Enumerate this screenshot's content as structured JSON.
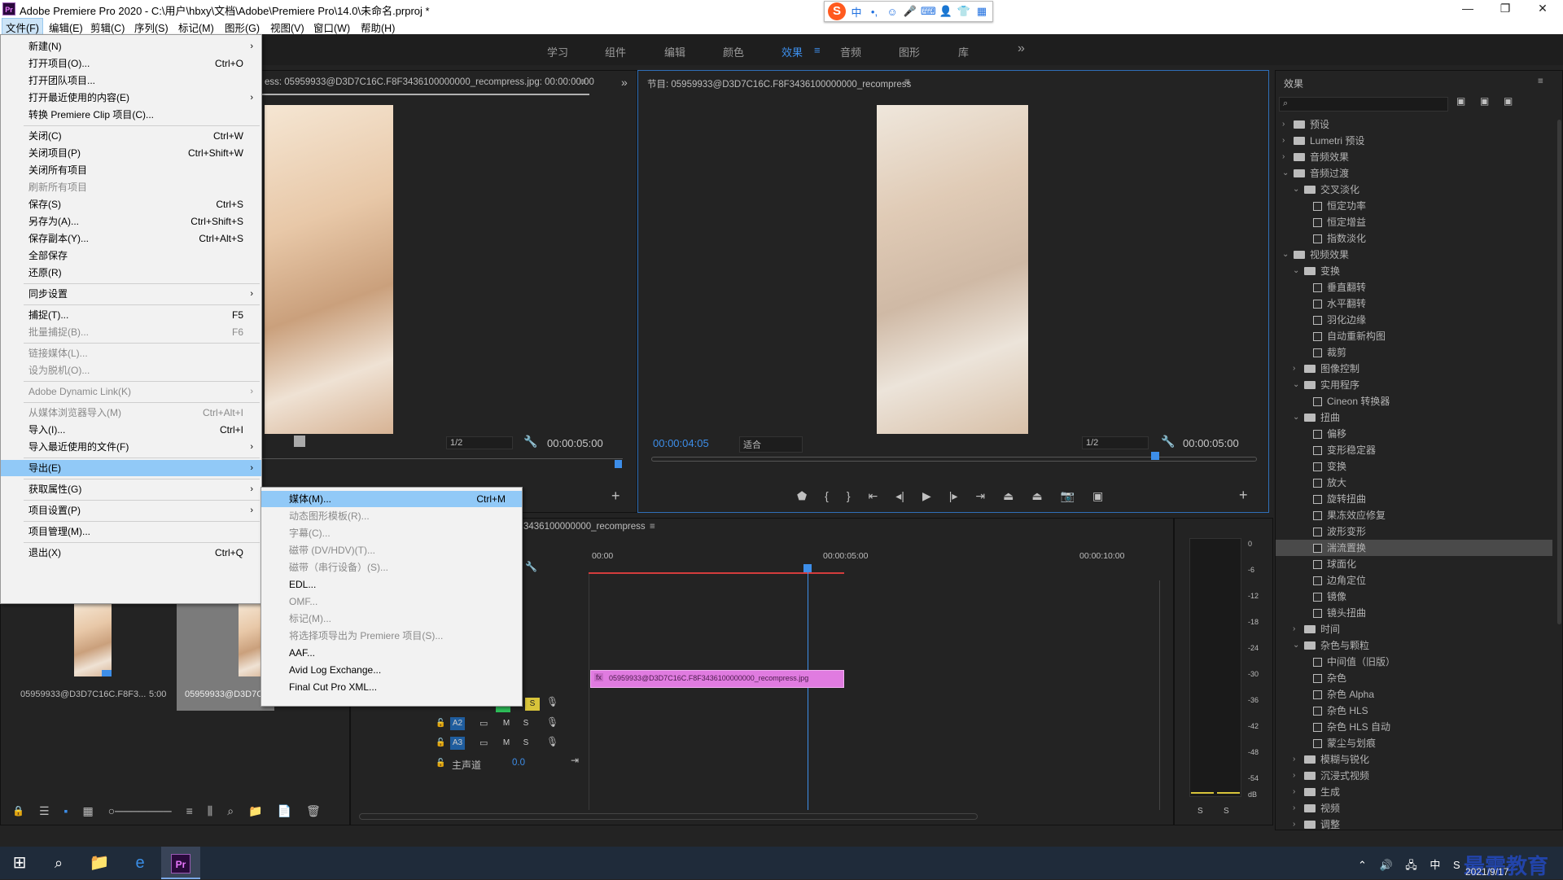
{
  "titlebar": {
    "app_logo": "Pr",
    "title": "Adobe Premiere Pro 2020 - C:\\用户\\hbxy\\文档\\Adobe\\Premiere Pro\\14.0\\未命名.prproj *",
    "minimize": "—",
    "maximize": "❐",
    "close": "✕"
  },
  "ime": {
    "logo": "S",
    "items": [
      "中",
      "•,",
      "☺",
      "🎤",
      "⌨",
      "👤",
      "👕",
      "▦"
    ]
  },
  "menubar": [
    "文件(F)",
    "编辑(E)",
    "剪辑(C)",
    "序列(S)",
    "标记(M)",
    "图形(G)",
    "视图(V)",
    "窗口(W)",
    "帮助(H)"
  ],
  "workspaces": {
    "tabs": [
      "学习",
      "组件",
      "编辑",
      "颜色",
      "效果",
      "音频",
      "图形",
      "库"
    ],
    "active": "效果",
    "more": "»"
  },
  "source_monitor": {
    "title": "ess: 05959933@D3D7C16C.F8F3436100000000_recompress.jpg: 00:00:00:00",
    "zoom": "1/2",
    "duration": "00:00:05:00"
  },
  "program_monitor": {
    "title": "节目: 05959933@D3D7C16C.F8F3436100000000_recompress",
    "current_time": "00:00:04:05",
    "fit": "适合",
    "zoom": "1/2",
    "duration": "00:00:05:00"
  },
  "timeline": {
    "title": "3436100000000_recompress",
    "ruler": [
      "00:00",
      "00:00:05:00",
      "00:00:10:00"
    ],
    "clip_label": "05959933@D3D7C16C.F8F3436100000000_recompress.jpg",
    "clip_fx": "fx",
    "tracks": [
      {
        "name": "A2",
        "m": "M",
        "s": "S"
      },
      {
        "name": "A3",
        "m": "M",
        "s": "S"
      }
    ],
    "v_s": "S",
    "master_label": "主声道",
    "master_value": "0.0"
  },
  "project": {
    "items": [
      {
        "name": "05959933@D3D7C16C.F8F3...",
        "duration": "5:00"
      },
      {
        "name": "05959933@D3D7C",
        "duration": ""
      }
    ]
  },
  "meter": {
    "scale": [
      "0",
      "-6",
      "-12",
      "-18",
      "-24",
      "-30",
      "-36",
      "-42",
      "-48",
      "-54",
      "dB"
    ],
    "s1": "S",
    "s2": "S"
  },
  "effects": {
    "title": "效果",
    "tree": [
      {
        "label": "预设",
        "level": 0,
        "type": "folder",
        "open": false
      },
      {
        "label": "Lumetri 预设",
        "level": 0,
        "type": "folder",
        "open": false
      },
      {
        "label": "音频效果",
        "level": 0,
        "type": "folder",
        "open": false
      },
      {
        "label": "音频过渡",
        "level": 0,
        "type": "folder",
        "open": true
      },
      {
        "label": "交叉淡化",
        "level": 1,
        "type": "folder",
        "open": true
      },
      {
        "label": "恒定功率",
        "level": 2,
        "type": "fx"
      },
      {
        "label": "恒定增益",
        "level": 2,
        "type": "fx"
      },
      {
        "label": "指数淡化",
        "level": 2,
        "type": "fx"
      },
      {
        "label": "视频效果",
        "level": 0,
        "type": "folder",
        "open": true
      },
      {
        "label": "变换",
        "level": 1,
        "type": "folder",
        "open": true
      },
      {
        "label": "垂直翻转",
        "level": 2,
        "type": "fx"
      },
      {
        "label": "水平翻转",
        "level": 2,
        "type": "fx"
      },
      {
        "label": "羽化边缘",
        "level": 2,
        "type": "fx"
      },
      {
        "label": "自动重新构图",
        "level": 2,
        "type": "fx"
      },
      {
        "label": "裁剪",
        "level": 2,
        "type": "fx"
      },
      {
        "label": "图像控制",
        "level": 1,
        "type": "folder",
        "open": false
      },
      {
        "label": "实用程序",
        "level": 1,
        "type": "folder",
        "open": true
      },
      {
        "label": "Cineon 转换器",
        "level": 2,
        "type": "fx"
      },
      {
        "label": "扭曲",
        "level": 1,
        "type": "folder",
        "open": true
      },
      {
        "label": "偏移",
        "level": 2,
        "type": "fx"
      },
      {
        "label": "变形稳定器",
        "level": 2,
        "type": "fx"
      },
      {
        "label": "变换",
        "level": 2,
        "type": "fx"
      },
      {
        "label": "放大",
        "level": 2,
        "type": "fx"
      },
      {
        "label": "旋转扭曲",
        "level": 2,
        "type": "fx"
      },
      {
        "label": "果冻效应修复",
        "level": 2,
        "type": "fx"
      },
      {
        "label": "波形变形",
        "level": 2,
        "type": "fx"
      },
      {
        "label": "湍流置换",
        "level": 2,
        "type": "fx",
        "selected": true
      },
      {
        "label": "球面化",
        "level": 2,
        "type": "fx"
      },
      {
        "label": "边角定位",
        "level": 2,
        "type": "fx"
      },
      {
        "label": "镜像",
        "level": 2,
        "type": "fx"
      },
      {
        "label": "镜头扭曲",
        "level": 2,
        "type": "fx"
      },
      {
        "label": "时间",
        "level": 1,
        "type": "folder",
        "open": false
      },
      {
        "label": "杂色与颗粒",
        "level": 1,
        "type": "folder",
        "open": true
      },
      {
        "label": "中间值（旧版）",
        "level": 2,
        "type": "fx"
      },
      {
        "label": "杂色",
        "level": 2,
        "type": "fx"
      },
      {
        "label": "杂色 Alpha",
        "level": 2,
        "type": "fx"
      },
      {
        "label": "杂色 HLS",
        "level": 2,
        "type": "fx"
      },
      {
        "label": "杂色 HLS 自动",
        "level": 2,
        "type": "fx"
      },
      {
        "label": "蒙尘与划痕",
        "level": 2,
        "type": "fx"
      },
      {
        "label": "模糊与锐化",
        "level": 1,
        "type": "folder",
        "open": false
      },
      {
        "label": "沉浸式视频",
        "level": 1,
        "type": "folder",
        "open": false
      },
      {
        "label": "生成",
        "level": 1,
        "type": "folder",
        "open": false
      },
      {
        "label": "视频",
        "level": 1,
        "type": "folder",
        "open": false
      },
      {
        "label": "调整",
        "level": 1,
        "type": "folder",
        "open": false
      }
    ]
  },
  "file_menu": {
    "items": [
      {
        "label": "新建(N)",
        "shortcut": "",
        "sub": true
      },
      {
        "label": "打开项目(O)...",
        "shortcut": "Ctrl+O"
      },
      {
        "label": "打开团队项目..."
      },
      {
        "label": "打开最近使用的内容(E)",
        "sub": true
      },
      {
        "label": "转换 Premiere Clip 项目(C)..."
      },
      {
        "sep": true
      },
      {
        "label": "关闭(C)",
        "shortcut": "Ctrl+W"
      },
      {
        "label": "关闭项目(P)",
        "shortcut": "Ctrl+Shift+W"
      },
      {
        "label": "关闭所有项目"
      },
      {
        "label": "刷新所有项目",
        "disabled": true
      },
      {
        "label": "保存(S)",
        "shortcut": "Ctrl+S"
      },
      {
        "label": "另存为(A)...",
        "shortcut": "Ctrl+Shift+S"
      },
      {
        "label": "保存副本(Y)...",
        "shortcut": "Ctrl+Alt+S"
      },
      {
        "label": "全部保存"
      },
      {
        "label": "还原(R)"
      },
      {
        "sep": true
      },
      {
        "label": "同步设置",
        "sub": true
      },
      {
        "sep": true
      },
      {
        "label": "捕捉(T)...",
        "shortcut": "F5"
      },
      {
        "label": "批量捕捉(B)...",
        "shortcut": "F6",
        "disabled": true
      },
      {
        "sep": true
      },
      {
        "label": "链接媒体(L)...",
        "disabled": true
      },
      {
        "label": "设为脱机(O)...",
        "disabled": true
      },
      {
        "sep": true
      },
      {
        "label": "Adobe Dynamic Link(K)",
        "sub": true,
        "disabled": true
      },
      {
        "sep": true
      },
      {
        "label": "从媒体浏览器导入(M)",
        "shortcut": "Ctrl+Alt+I",
        "disabled": true
      },
      {
        "label": "导入(I)...",
        "shortcut": "Ctrl+I"
      },
      {
        "label": "导入最近使用的文件(F)",
        "sub": true
      },
      {
        "sep": true
      },
      {
        "label": "导出(E)",
        "sub": true,
        "highlight": true
      },
      {
        "sep": true
      },
      {
        "label": "获取属性(G)",
        "sub": true
      },
      {
        "sep": true
      },
      {
        "label": "项目设置(P)",
        "sub": true
      },
      {
        "sep": true
      },
      {
        "label": "项目管理(M)..."
      },
      {
        "sep": true
      },
      {
        "label": "退出(X)",
        "shortcut": "Ctrl+Q"
      }
    ]
  },
  "export_menu": {
    "items": [
      {
        "label": "媒体(M)...",
        "shortcut": "Ctrl+M",
        "highlight": true
      },
      {
        "label": "动态图形模板(R)...",
        "disabled": true
      },
      {
        "label": "字幕(C)...",
        "disabled": true
      },
      {
        "label": "磁带 (DV/HDV)(T)...",
        "disabled": true
      },
      {
        "label": "磁带（串行设备）(S)...",
        "disabled": true
      },
      {
        "label": "EDL..."
      },
      {
        "label": "OMF...",
        "disabled": true
      },
      {
        "label": "标记(M)...",
        "disabled": true
      },
      {
        "label": "将选择项导出为 Premiere 项目(S)...",
        "disabled": true
      },
      {
        "label": "AAF..."
      },
      {
        "label": "Avid Log Exchange..."
      },
      {
        "label": "Final Cut Pro XML..."
      }
    ]
  },
  "taskbar": {
    "date": "2021/9/17",
    "watermark": "最需教育"
  },
  "colors": {
    "accent": "#3d8ee9",
    "clip": "#e07be0",
    "playhead": "#3d8ee9",
    "menu_highlight": "#91c9f7"
  }
}
